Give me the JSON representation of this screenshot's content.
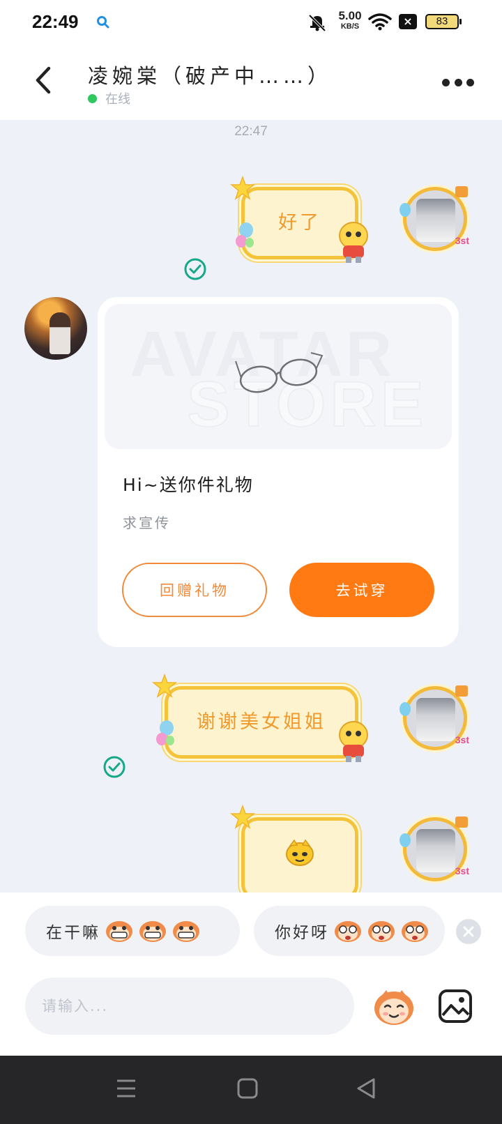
{
  "status_bar": {
    "time": "22:49",
    "net_speed_value": "5.00",
    "net_speed_unit": "KB/S",
    "battery": "83"
  },
  "header": {
    "title": "凌婉棠（破产中……）",
    "status": "在线"
  },
  "chat": {
    "timestamp": "22:47",
    "messages": [
      {
        "side": "right",
        "type": "text",
        "text": "好了",
        "status": "read"
      },
      {
        "side": "left",
        "type": "gift_card",
        "image_watermark": [
          "AVATAR",
          "STORE"
        ],
        "title": "Hi~送你件礼物",
        "subtitle": "求宣传",
        "return_button": "回赠礼物",
        "try_button": "去试穿"
      },
      {
        "side": "right",
        "type": "text",
        "text": "谢谢美女姐姐",
        "status": "read"
      },
      {
        "side": "right",
        "type": "sticker",
        "status": "sending"
      }
    ]
  },
  "quick_replies": [
    {
      "text": "在干嘛"
    },
    {
      "text": "你好呀"
    }
  ],
  "input": {
    "placeholder": "请输入..."
  },
  "colors": {
    "accent": "#ff7a12",
    "online": "#2ec85e",
    "read_check": "#17a88a",
    "bubble_border": "#f4c33a",
    "bubble_fill": "#fdf4cf"
  },
  "icons": [
    "search-icon",
    "bell-off-icon",
    "wifi-icon",
    "close-icon",
    "back-icon",
    "more-icon",
    "check-circle-icon",
    "emoji-icon",
    "image-icon",
    "menu-icon",
    "home-icon",
    "back-triangle-icon"
  ]
}
